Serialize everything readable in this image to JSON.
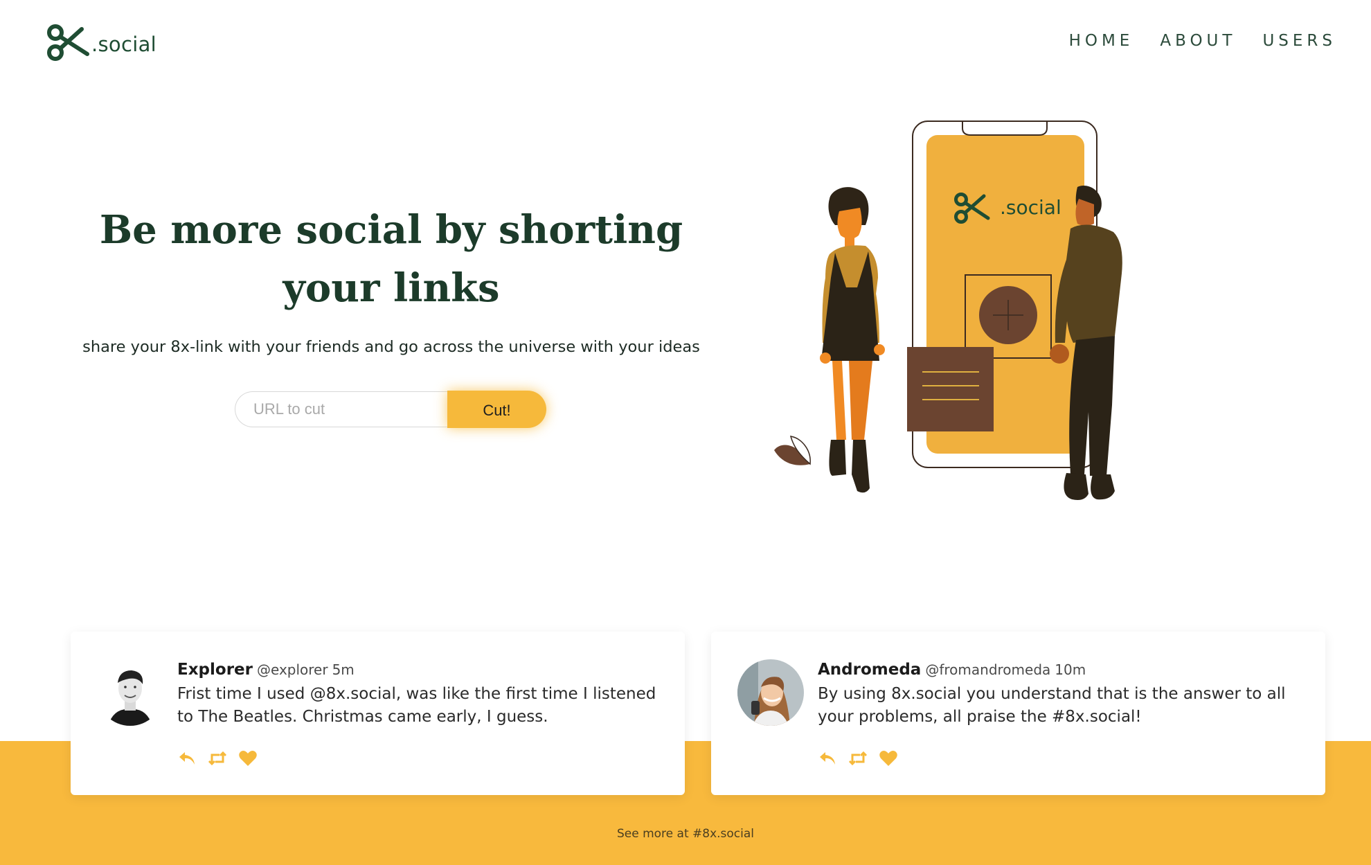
{
  "brand": {
    "name": ".social",
    "colors": {
      "primary": "#1f4d33",
      "accent": "#f6b93b",
      "band": "#f8b93d"
    }
  },
  "nav": {
    "items": [
      {
        "label": "HOME"
      },
      {
        "label": "ABOUT"
      },
      {
        "label": "USERS"
      }
    ]
  },
  "hero": {
    "title": "Be more social by shorting your links",
    "subtitle": "share your 8x-link with your friends and go across the universe with your ideas",
    "input_placeholder": "URL to cut",
    "button_label": "Cut!",
    "illustration_logo_text": ".social"
  },
  "tweets": [
    {
      "name": "Explorer",
      "handle": "@explorer",
      "time": "5m",
      "text": "Frist time I used @8x.social, was like the first time I listened to The Beatles. Christmas came early, I guess.",
      "actions": [
        "reply-icon",
        "retweet-icon",
        "heart-icon"
      ]
    },
    {
      "name": "Andromeda",
      "handle": "@fromandromeda",
      "time": "10m",
      "text": "By using 8x.social you understand that is the answer to all your problems, all praise the #8x.social!",
      "actions": [
        "reply-icon",
        "retweet-icon",
        "heart-icon"
      ]
    }
  ],
  "footer": {
    "see_more": "See more at #8x.social"
  }
}
